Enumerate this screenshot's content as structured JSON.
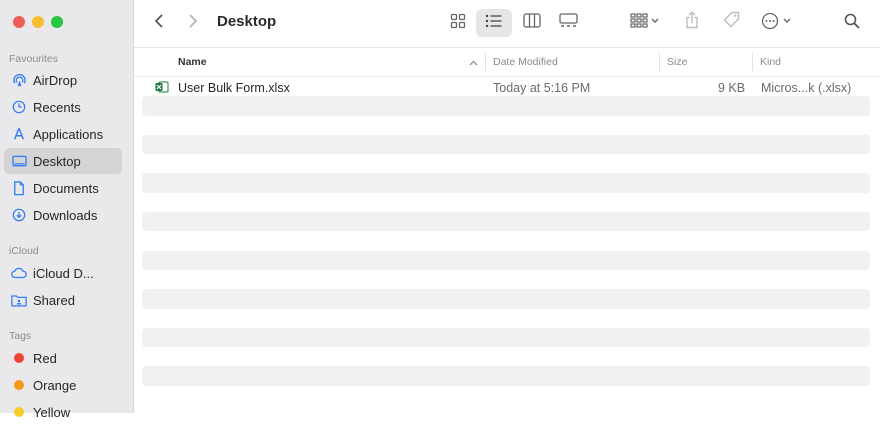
{
  "window": {
    "traffic_colors": {
      "close": "#ee5e57",
      "minimize": "#f5bd30",
      "zoom": "#27c73f"
    }
  },
  "sidebar": {
    "favourites_label": "Favourites",
    "favourites": [
      {
        "label": "AirDrop",
        "icon": "airdrop-icon"
      },
      {
        "label": "Recents",
        "icon": "clock-icon"
      },
      {
        "label": "Applications",
        "icon": "applications-icon"
      },
      {
        "label": "Desktop",
        "icon": "desktop-icon",
        "selected": true
      },
      {
        "label": "Documents",
        "icon": "document-icon"
      },
      {
        "label": "Downloads",
        "icon": "download-icon"
      }
    ],
    "icloud_label": "iCloud",
    "icloud": [
      {
        "label": "iCloud D...",
        "icon": "cloud-icon"
      },
      {
        "label": "Shared",
        "icon": "shared-folder-icon"
      }
    ],
    "tags_label": "Tags",
    "tags": [
      {
        "label": "Red",
        "color": "#ef4538"
      },
      {
        "label": "Orange",
        "color": "#f39a1d"
      },
      {
        "label": "Yellow",
        "color": "#f5cc2a"
      }
    ],
    "icon_color": "#2f7cf6"
  },
  "toolbar": {
    "title": "Desktop",
    "icons": [
      "back-icon",
      "forward-icon",
      "grid-view-icon",
      "list-view-icon",
      "column-view-icon",
      "gallery-view-icon",
      "group-icon",
      "share-icon",
      "tag-icon",
      "more-icon",
      "search-icon"
    ]
  },
  "columns": {
    "name": "Name",
    "date": "Date Modified",
    "size": "Size",
    "kind": "Kind"
  },
  "files": [
    {
      "name": "User Bulk Form.xlsx",
      "date": "Today at 5:16 PM",
      "size": "9 KB",
      "kind": "Micros...k (.xlsx)",
      "icon": "excel-file-icon"
    }
  ]
}
